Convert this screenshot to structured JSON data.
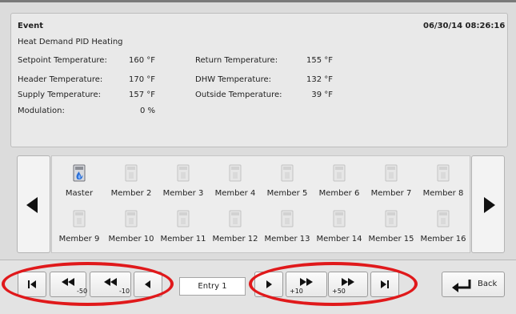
{
  "event": {
    "title": "Event",
    "timestamp": "06/30/14 08:26:16",
    "name": "Heat Demand PID Heating",
    "fields_left": [
      {
        "label": "Setpoint Temperature:",
        "value": "160 °F"
      },
      {
        "label": "Header Temperature:",
        "value": "170 °F"
      },
      {
        "label": "Supply Temperature:",
        "value": "157 °F"
      },
      {
        "label": "Modulation:",
        "value": "0 %"
      }
    ],
    "fields_right": [
      {
        "label": "Return Temperature:",
        "value": "155 °F"
      },
      {
        "label": "DHW Temperature:",
        "value": "132 °F"
      },
      {
        "label": "Outside Temperature:",
        "value": "39 °F"
      }
    ]
  },
  "members": [
    {
      "label": "Master",
      "icon": "boiler-active-icon"
    },
    {
      "label": "Member 2",
      "icon": "boiler-inactive-icon"
    },
    {
      "label": "Member 3",
      "icon": "boiler-inactive-icon"
    },
    {
      "label": "Member 4",
      "icon": "boiler-inactive-icon"
    },
    {
      "label": "Member 5",
      "icon": "boiler-inactive-icon"
    },
    {
      "label": "Member 6",
      "icon": "boiler-inactive-icon"
    },
    {
      "label": "Member 7",
      "icon": "boiler-inactive-icon"
    },
    {
      "label": "Member 8",
      "icon": "boiler-inactive-icon"
    },
    {
      "label": "Member 9",
      "icon": "boiler-inactive-icon"
    },
    {
      "label": "Member 10",
      "icon": "boiler-inactive-icon"
    },
    {
      "label": "Member 11",
      "icon": "boiler-inactive-icon"
    },
    {
      "label": "Member 12",
      "icon": "boiler-inactive-icon"
    },
    {
      "label": "Member 13",
      "icon": "boiler-inactive-icon"
    },
    {
      "label": "Member 14",
      "icon": "boiler-inactive-icon"
    },
    {
      "label": "Member 15",
      "icon": "boiler-inactive-icon"
    },
    {
      "label": "Member 16",
      "icon": "boiler-inactive-icon"
    }
  ],
  "nav": {
    "back_50": "-50",
    "back_10": "-10",
    "fwd_10": "+10",
    "fwd_50": "+50",
    "entry": "Entry 1",
    "back_label": "Back"
  },
  "colors": {
    "highlight": "#e0191b",
    "flame": "#2a6fd6"
  }
}
